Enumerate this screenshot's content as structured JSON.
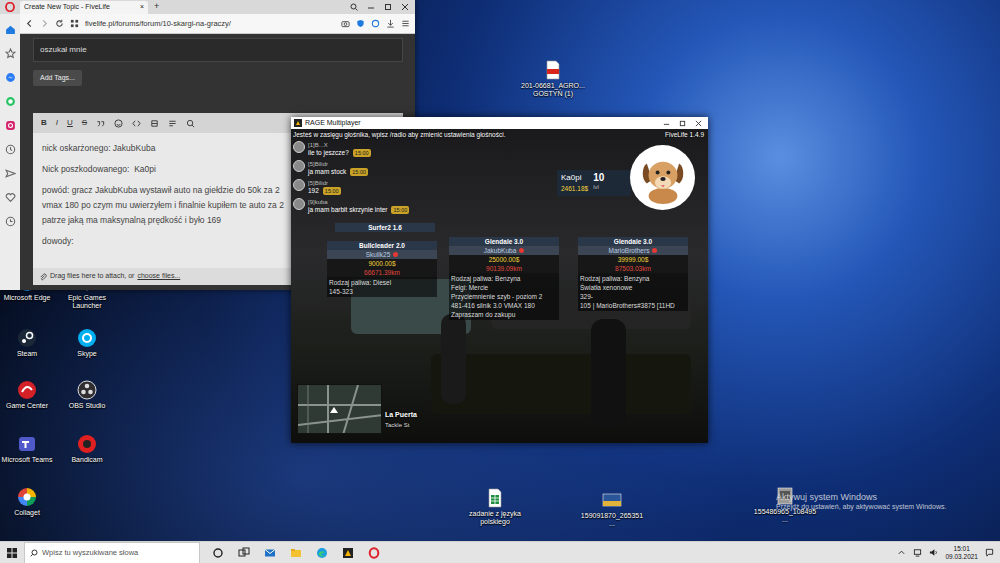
{
  "browser": {
    "tab": {
      "title": "Create New Topic - FiveLife",
      "close": "×"
    },
    "new_tab": "+",
    "url": "fivelife.pl/forums/forum/10-skargi-na-graczy/",
    "topic_title": "oszukał mnie",
    "add_tags": "Add Tags...",
    "toolbar": [
      "B",
      "I",
      "U",
      "S"
    ],
    "editor": [
      [
        "nick oskarżonego: JakubKuba"
      ],
      [
        "Nick poszkodowanego:  Ka0pi"
      ],
      [
        "powód: gracz JakubKuba wystawił auto na giełdzie do 50k za 2",
        "vmax 180 po czym mu uwierzyłem i finalnie kupiłem te auto za 2",
        "patrze jaką ma maksynalną prędkość i było 169"
      ],
      [
        "dowody:"
      ]
    ],
    "attach": {
      "text": "Drag files here to attach, or",
      "link": "choose files..."
    }
  },
  "game": {
    "title": "RAGE Multiplayer",
    "notice": "Jesteś w zasięgu głośnika, wpisz /radio aby zmienić ustawienia głośności.",
    "version": "FiveLife 1.4.9",
    "chat": [
      {
        "name": "[1]B...X",
        "message": "ile to jeszcze?",
        "time": "15:00"
      },
      {
        "name": "[5]Bilidr",
        "message": "ja mam stock",
        "time": "15:00"
      },
      {
        "name": "[5]Bilidr",
        "message": "192",
        "time": "15:00"
      },
      {
        "name": "[9]kuba",
        "message": "ja mam barbit skrzynie inter",
        "time": "15:00"
      }
    ],
    "player": {
      "name": "Ka0pi",
      "money": "2461.18$",
      "level": "10",
      "level_label": "lvl"
    },
    "vehicles": [
      {
        "name": "Surfer2 1.6"
      },
      {
        "name": "Bullcleader 2.0",
        "owner": "Skulik25",
        "price": "9000.00$",
        "mileage": "66671.39km",
        "details": [
          "Rodzaj paliwa: Diesel",
          "145-323"
        ]
      },
      {
        "name": "Glendale 3.0",
        "owner": "JakubKuba",
        "price": "25000.00$",
        "mileage": "90139.09km",
        "details": [
          "Rodzaj paliwa: Benzyna",
          "Felgi: Mercie",
          "Przyciemnienie szyb - poziom 2",
          "481-416 silnik 3.0 VMAX 180",
          "Zapraszam do zakupu"
        ]
      },
      {
        "name": "Glendale 3.0",
        "owner": "MarioBrothers",
        "price": "39999.00$",
        "mileage": "87503.03km",
        "details": [
          "Rodzaj paliwa: Benzyna",
          "Światła xenonowe",
          "329-",
          "105 | MarioBrothers#3875 [11HD"
        ]
      }
    ],
    "minimap": {
      "street": "La Puerta",
      "area": "Tackle St"
    }
  },
  "desktop_icons": [
    {
      "label": "Microsoft Edge"
    },
    {
      "label": "Epic Games Launcher"
    },
    {
      "label": "Steam"
    },
    {
      "label": "Skype"
    },
    {
      "label": "Game Center"
    },
    {
      "label": "OBS Studio"
    },
    {
      "label": "Microsoft Teams"
    },
    {
      "label": "Bandicam"
    },
    {
      "label": "Collaget"
    },
    {
      "label": "201-06681_AGRO... GOSTYŃ (1)"
    },
    {
      "label": "zadanie z języka polskiego"
    },
    {
      "label": "159091870_265351..."
    },
    {
      "label": "155486965_108495..."
    }
  ],
  "watermark": {
    "title": "Aktywuj system Windows",
    "subtitle": "Przejdź do ustawień, aby aktywować system Windows."
  },
  "taskbar": {
    "search_placeholder": "Wpisz tu wyszukiwane słowa",
    "time": "15:01",
    "date": "09.03.2021"
  }
}
